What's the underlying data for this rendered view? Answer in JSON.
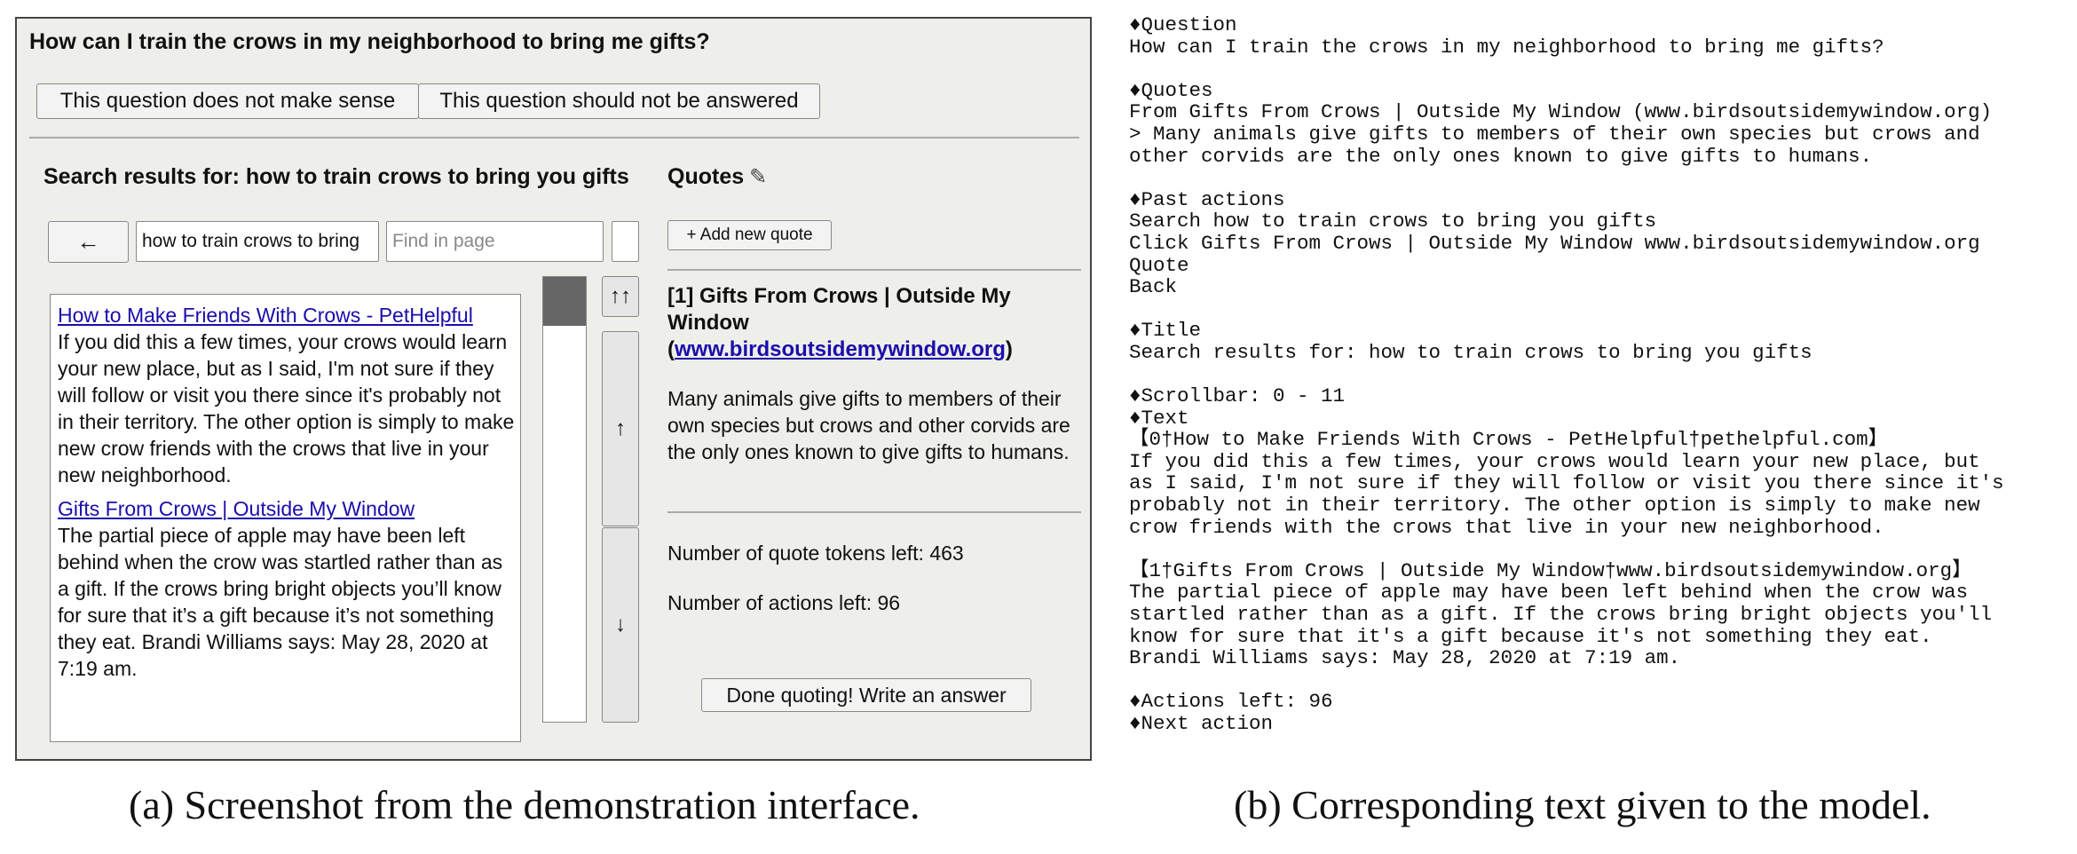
{
  "panel_a": {
    "question": "How can I train the crows in my neighborhood to bring me gifts?",
    "buttons": {
      "no_sense": "This question does not make sense",
      "no_answer": "This question should not be answered",
      "back": "←",
      "add_quote": "+ Add new quote",
      "scroll_top": "↑↑",
      "scroll_up": "↑",
      "scroll_down": "↓",
      "done": "Done quoting! Write an answer"
    },
    "search_title": "Search results for: how to train crows to bring you gifts",
    "quotes_title": "Quotes",
    "quotes_icon": "✎",
    "search_value": "how to train crows to bring",
    "find_placeholder": "Find in page",
    "results": [
      {
        "title": "How to Make Friends With Crows - PetHelpful",
        "body": "If you did this a few times, your crows would learn your new place, but as I said, I'm not sure if they will follow or visit you there since it's probably not in their territory. The other option is simply to make new crow friends with the crows that live in your new neighborhood."
      },
      {
        "title": "Gifts From Crows | Outside My Window",
        "body": "The partial piece of apple may have been left behind when the crow was startled rather than as a gift. If the crows bring bright objects you’ll know for sure that it’s a gift because it’s not something they eat. Brandi Williams says: May 28, 2020 at 7:19 am."
      }
    ],
    "quote": {
      "prefix": "[1] Gifts From Crows | Outside My Window",
      "link": "www.birdsoutsidemywindow.org",
      "text": "Many animals give gifts to members of their own species but crows and other corvids are the only ones known to give gifts to humans."
    },
    "tokens_left": "Number of quote tokens left: 463",
    "actions_left": "Number of actions left: 96"
  },
  "panel_b": {
    "lines": [
      "♦Question",
      "How can I train the crows in my neighborhood to bring me gifts?",
      "",
      "♦Quotes",
      "From Gifts From Crows | Outside My Window (www.birdsoutsidemywindow.org)",
      "> Many animals give gifts to members of their own species but crows and",
      "other corvids are the only ones known to give gifts to humans.",
      "",
      "♦Past actions",
      "Search how to train crows to bring you gifts",
      "Click Gifts From Crows | Outside My Window www.birdsoutsidemywindow.org",
      "Quote",
      "Back",
      "",
      "♦Title",
      "Search results for: how to train crows to bring you gifts",
      "",
      "♦Scrollbar: 0 - 11",
      "♦Text",
      "【0†How to Make Friends With Crows - PetHelpful†pethelpful.com】",
      "If you did this a few times, your crows would learn your new place, but",
      "as I said, I'm not sure if they will follow or visit you there since it's",
      "probably not in their territory. The other option is simply to make new",
      "crow friends with the crows that live in your new neighborhood.",
      "",
      "【1†Gifts From Crows | Outside My Window†www.birdsoutsidemywindow.org】",
      "The partial piece of apple may have been left behind when the crow was",
      "startled rather than as a gift. If the crows bring bright objects you'll",
      "know for sure that it's a gift because it's not something they eat.",
      "Brandi Williams says: May 28, 2020 at 7:19 am.",
      "",
      "♦Actions left: 96",
      "♦Next action"
    ]
  },
  "captions": {
    "a": "(a) Screenshot from the demonstration interface.",
    "b": "(b) Corresponding text given to the model."
  }
}
